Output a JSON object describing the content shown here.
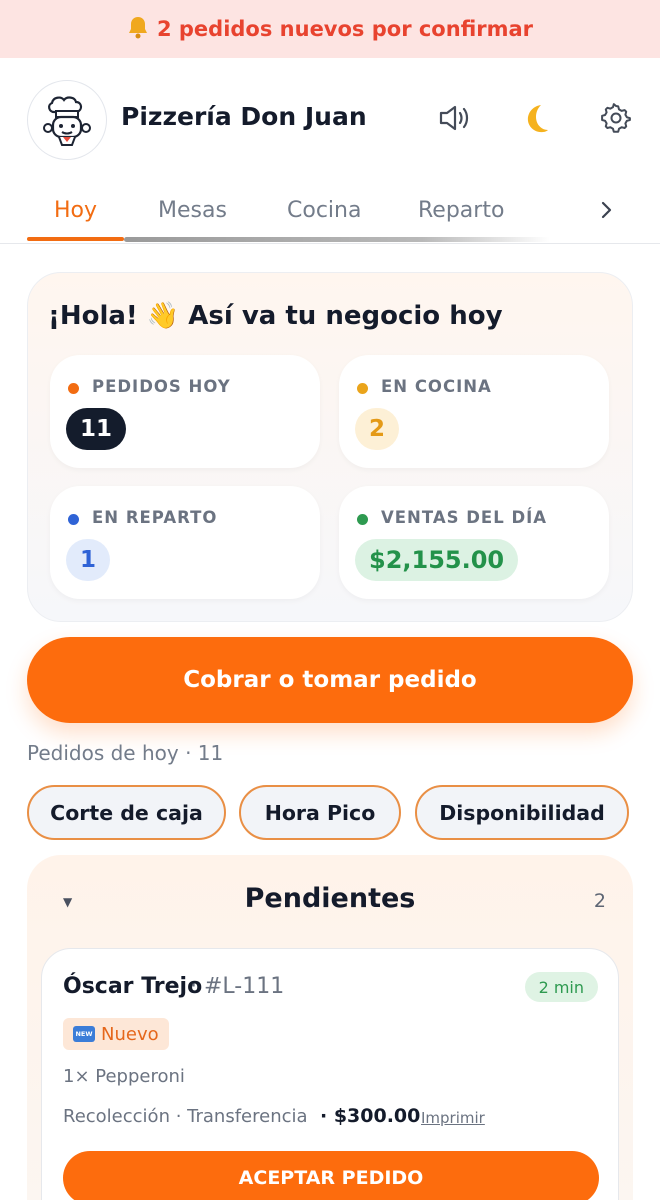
{
  "banner": {
    "icon": "bell-icon",
    "text": "2 pedidos nuevos por confirmar"
  },
  "header": {
    "business_name": "Pizzería Don Juan",
    "icons": [
      "volume-icon",
      "moon-icon",
      "gear-icon"
    ]
  },
  "tabs": [
    {
      "label": "Hoy",
      "active": true
    },
    {
      "label": "Mesas",
      "active": false
    },
    {
      "label": "Cocina",
      "active": false
    },
    {
      "label": "Reparto",
      "active": false
    }
  ],
  "summary": {
    "title": "¡Hola! 👋 Así va tu negocio hoy",
    "stats": [
      {
        "label": "PEDIDOS HOY",
        "value": "11",
        "color": "#f26c12"
      },
      {
        "label": "EN COCINA",
        "value": "2",
        "color": "#eaa41b"
      },
      {
        "label": "EN REPARTO",
        "value": "1",
        "color": "#2f63d6"
      },
      {
        "label": "VENTAS DEL DÍA",
        "value": "$2,155.00",
        "color": "#2e9a50"
      }
    ]
  },
  "cta_label": "Cobrar o tomar pedido",
  "orders_today": "Pedidos de hoy · 11",
  "chips": [
    "Corte de caja",
    "Hora Pico",
    "Disponibilidad"
  ],
  "pending": {
    "title": "Pendientes",
    "count": "2",
    "order": {
      "customer": "Óscar Trejo",
      "id": "· #L-111",
      "elapsed": "2 min",
      "badge": "Nuevo",
      "badge_icon": "NEW",
      "items": "1× Pepperoni",
      "meta": "Recolección · Transferencia",
      "amount": "· $300.00",
      "print_label": "Imprimir",
      "accept_label": "ACEPTAR PEDIDO"
    }
  },
  "colors": {
    "accent": "#fd6c0d",
    "banner_bg": "#fde4e2",
    "banner_text": "#e8432f"
  }
}
